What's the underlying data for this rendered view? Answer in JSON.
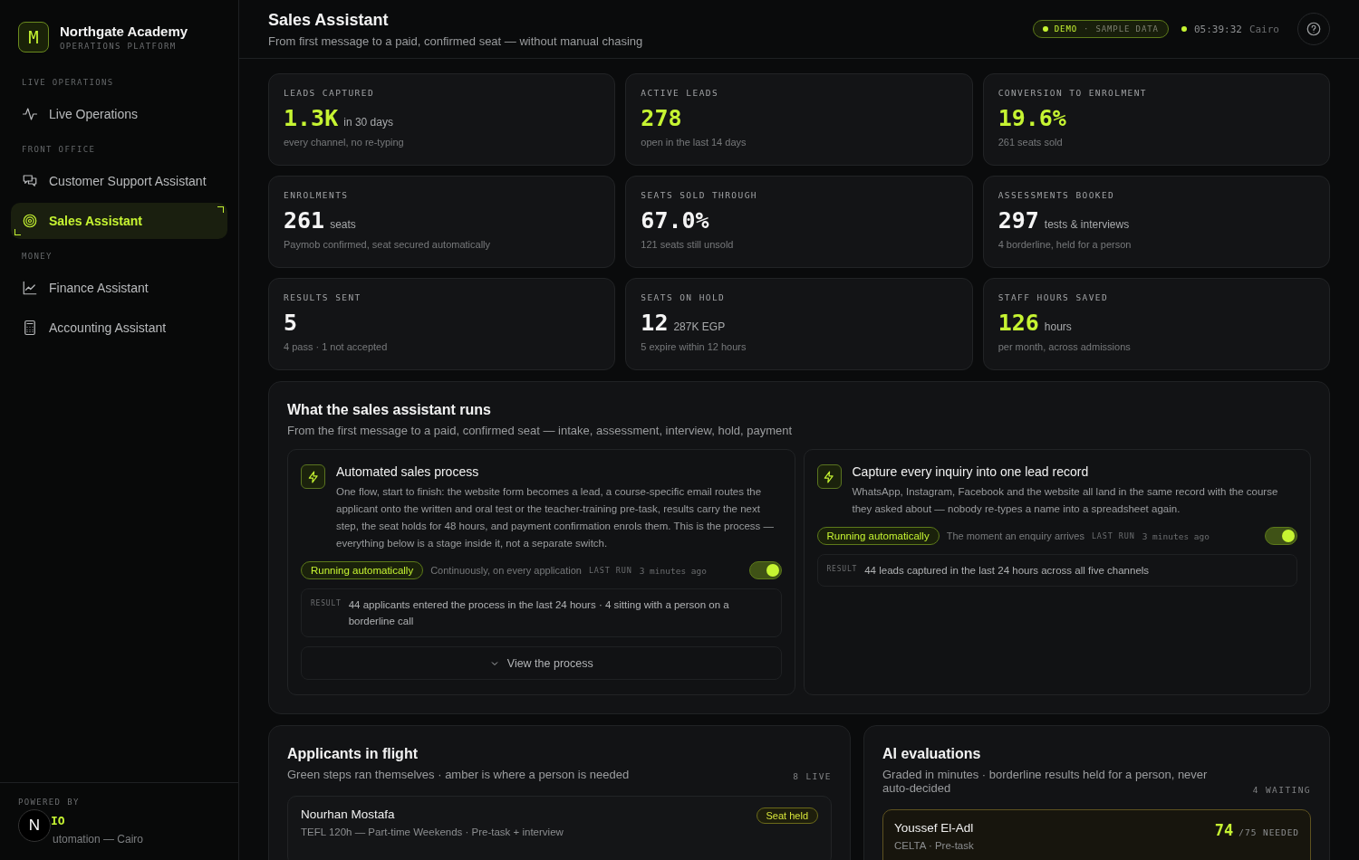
{
  "sidebar": {
    "brand": {
      "logo_letter": "M",
      "name": "Northgate Academy",
      "subtitle": "OPERATIONS PLATFORM"
    },
    "sections": [
      {
        "heading": "LIVE OPERATIONS",
        "items": [
          {
            "label": "Live Operations",
            "selected": false
          }
        ]
      },
      {
        "heading": "FRONT OFFICE",
        "items": [
          {
            "label": "Customer Support Assistant",
            "selected": false
          },
          {
            "label": "Sales Assistant",
            "selected": true
          }
        ]
      },
      {
        "heading": "MONEY",
        "items": [
          {
            "label": "Finance Assistant",
            "selected": false
          },
          {
            "label": "Accounting Assistant",
            "selected": false
          }
        ]
      }
    ],
    "footer": {
      "caption": "POWERED BY",
      "brand": "IO",
      "tagline": "utomation — Cairo"
    }
  },
  "dev_badge": {
    "letter": "N"
  },
  "header": {
    "title": "Sales Assistant",
    "subtitle": "From first message to a paid, confirmed seat — without manual chasing",
    "demo_badge": {
      "label": "DEMO",
      "separator": "·",
      "text": "SAMPLE DATA"
    },
    "clock": {
      "time": "05:39:32",
      "city": "Cairo"
    }
  },
  "kpis": [
    {
      "label": "LEADS CAPTURED",
      "value": "1.3K",
      "unit": "in 30 days",
      "note": "every channel, no re-typing",
      "accent": true
    },
    {
      "label": "ACTIVE LEADS",
      "value": "278",
      "note": "open in the last 14 days",
      "accent": true
    },
    {
      "label": "CONVERSION TO ENROLMENT",
      "value": "19.6%",
      "note": "261 seats sold",
      "accent": true
    },
    {
      "label": "ENROLMENTS",
      "value": "261",
      "unit": "seats",
      "note": "Paymob confirmed, seat secured automatically",
      "accent": false
    },
    {
      "label": "SEATS SOLD THROUGH",
      "value": "67.0%",
      "note": "121 seats still unsold",
      "accent": false
    },
    {
      "label": "ASSESSMENTS BOOKED",
      "value": "297",
      "unit": "tests & interviews",
      "note": "4 borderline, held for a person",
      "accent": false
    },
    {
      "label": "RESULTS SENT",
      "value": "5",
      "note": "4 pass · 1 not accepted",
      "accent": false
    },
    {
      "label": "SEATS ON HOLD",
      "value": "12",
      "unit": "287K EGP",
      "note": "5 expire within 12 hours",
      "accent": false
    },
    {
      "label": "STAFF HOURS SAVED",
      "value": "126",
      "unit": "hours",
      "note": "per month, across admissions",
      "accent": true
    }
  ],
  "runs_panel": {
    "title": "What the sales assistant runs",
    "subtitle": "From the first message to a paid, confirmed seat — intake, assessment, interview, hold, payment",
    "automations": [
      {
        "title": "Automated sales process",
        "description": "One flow, start to finish: the website form becomes a lead, a course-specific email routes the applicant onto the written and oral test or the teacher-training pre-task, results carry the next step, the seat holds for 48 hours, and payment confirmation enrols them. This is the process — everything below is a stage inside it, not a separate switch.",
        "status": "Running automatically",
        "schedule": "Continuously, on every application",
        "last_run_label": "LAST RUN",
        "last_run": "3 minutes ago",
        "on": true,
        "result_label": "RESULT",
        "result": "44 applicants entered the process in the last 24 hours · 4 sitting with a person on a borderline call",
        "action": "View the process"
      },
      {
        "title": "Capture every inquiry into one lead record",
        "description": "WhatsApp, Instagram, Facebook and the website all land in the same record with the course they asked about — nobody re-types a name into a spreadsheet again.",
        "status": "Running automatically",
        "schedule": "The moment an enquiry arrives",
        "last_run_label": "LAST RUN",
        "last_run": "3 minutes ago",
        "on": true,
        "result_label": "RESULT",
        "result": "44 leads captured in the last 24 hours across all five channels"
      }
    ]
  },
  "applicants": {
    "title": "Applicants in flight",
    "subtitle": "Green steps ran themselves · amber is where a person is needed",
    "count": "8 LIVE",
    "items": [
      {
        "name": "Nourhan Mostafa",
        "detail": "TEFL 120h — Part-time Weekends · Pre-task + interview",
        "badge": "Seat held"
      }
    ]
  },
  "evaluations": {
    "title": "AI evaluations",
    "subtitle": "Graded in minutes · borderline results held for a person, never auto-decided",
    "count": "4 WAITING",
    "items": [
      {
        "name": "Youssef El-Adl",
        "detail": "CELTA · Pre-task",
        "score": "74",
        "needed": "/75 NEEDED"
      }
    ]
  }
}
